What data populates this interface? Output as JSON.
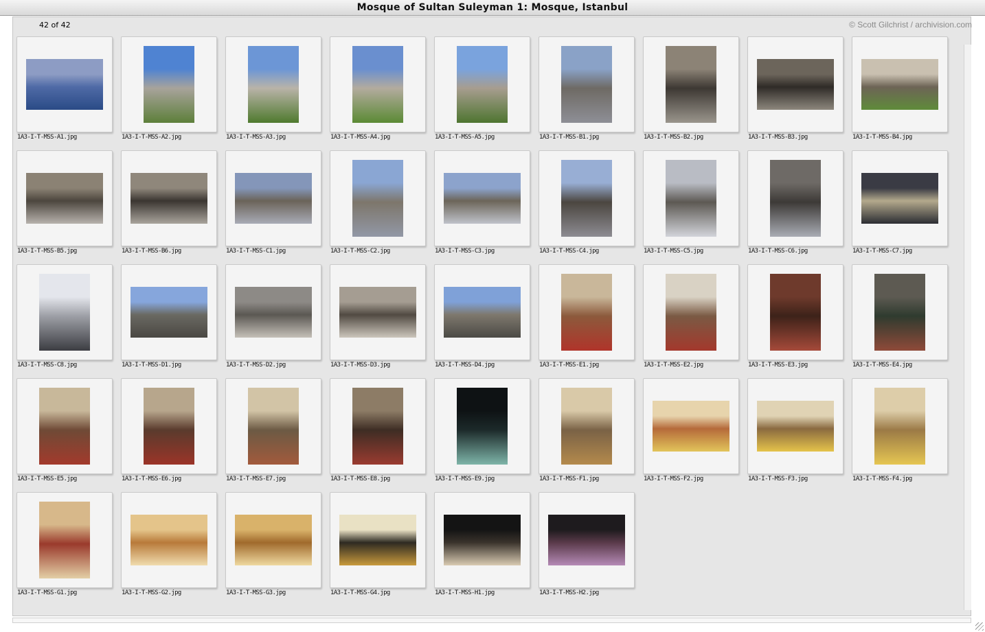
{
  "window": {
    "title": "Mosque of Sultan Suleyman 1: Mosque, Istanbul",
    "count_label": "42 of 42",
    "credit": "© Scott Gilchrist / archivision.com"
  },
  "thumbnails": [
    {
      "file": "1A3-I-T-MSS-A1.jpg",
      "orientation": "landscape",
      "colors": [
        "#8d9cc4",
        "#4f6aa6",
        "#2a4b86"
      ]
    },
    {
      "file": "1A3-I-T-MSS-A2.jpg",
      "orientation": "portrait",
      "colors": [
        "#4f83d2",
        "#a8a39b",
        "#5d7f3a"
      ]
    },
    {
      "file": "1A3-I-T-MSS-A3.jpg",
      "orientation": "portrait",
      "colors": [
        "#6c96d6",
        "#b9b3a8",
        "#4f7a2e"
      ]
    },
    {
      "file": "1A3-I-T-MSS-A4.jpg",
      "orientation": "portrait",
      "colors": [
        "#6a8fcf",
        "#b3ab9e",
        "#5b8a34"
      ]
    },
    {
      "file": "1A3-I-T-MSS-A5.jpg",
      "orientation": "portrait",
      "colors": [
        "#7aa3dd",
        "#a79d8f",
        "#4e7530"
      ]
    },
    {
      "file": "1A3-I-T-MSS-B1.jpg",
      "orientation": "portrait",
      "colors": [
        "#8aa2c7",
        "#6e6a64",
        "#8e8f96"
      ]
    },
    {
      "file": "1A3-I-T-MSS-B2.jpg",
      "orientation": "portrait",
      "colors": [
        "#8c8376",
        "#3d3833",
        "#9a958c"
      ]
    },
    {
      "file": "1A3-I-T-MSS-B3.jpg",
      "orientation": "landscape",
      "colors": [
        "#6c655b",
        "#2f2b27",
        "#8d877d"
      ]
    },
    {
      "file": "1A3-I-T-MSS-B4.jpg",
      "orientation": "landscape",
      "colors": [
        "#c9c0b0",
        "#6d6456",
        "#5f8b3a"
      ]
    },
    {
      "file": "1A3-I-T-MSS-B5.jpg",
      "orientation": "landscape",
      "colors": [
        "#8b8274",
        "#4c463e",
        "#b7b2ad"
      ]
    },
    {
      "file": "1A3-I-T-MSS-B6.jpg",
      "orientation": "landscape",
      "colors": [
        "#8f877b",
        "#3b3631",
        "#a9a49c"
      ]
    },
    {
      "file": "1A3-I-T-MSS-C1.jpg",
      "orientation": "landscape",
      "colors": [
        "#8496b9",
        "#6b6359",
        "#a8abb6"
      ]
    },
    {
      "file": "1A3-I-T-MSS-C2.jpg",
      "orientation": "portrait",
      "colors": [
        "#8aa6d3",
        "#7d766b",
        "#9298a6"
      ]
    },
    {
      "file": "1A3-I-T-MSS-C3.jpg",
      "orientation": "landscape",
      "colors": [
        "#8ca3cc",
        "#6c6559",
        "#bfc2ca"
      ]
    },
    {
      "file": "1A3-I-T-MSS-C4.jpg",
      "orientation": "portrait",
      "colors": [
        "#98aed4",
        "#4b4640",
        "#8d8c92"
      ]
    },
    {
      "file": "1A3-I-T-MSS-C5.jpg",
      "orientation": "portrait",
      "colors": [
        "#b9bcc4",
        "#5d5953",
        "#d2d4da"
      ]
    },
    {
      "file": "1A3-I-T-MSS-C6.jpg",
      "orientation": "portrait",
      "colors": [
        "#6e6a66",
        "#3d3a37",
        "#a9acb4"
      ]
    },
    {
      "file": "1A3-I-T-MSS-C7.jpg",
      "orientation": "landscape",
      "colors": [
        "#3a3b44",
        "#b3a98c",
        "#2c2d33"
      ]
    },
    {
      "file": "1A3-I-T-MSS-C8.jpg",
      "orientation": "portrait",
      "colors": [
        "#e4e6ec",
        "#9d9fa6",
        "#3c3d42"
      ]
    },
    {
      "file": "1A3-I-T-MSS-D1.jpg",
      "orientation": "landscape",
      "colors": [
        "#86a6dc",
        "#6a6962",
        "#4a4843"
      ]
    },
    {
      "file": "1A3-I-T-MSS-D2.jpg",
      "orientation": "landscape",
      "colors": [
        "#8d8a86",
        "#5b5853",
        "#c5c0b8"
      ]
    },
    {
      "file": "1A3-I-T-MSS-D3.jpg",
      "orientation": "landscape",
      "colors": [
        "#a59d92",
        "#514a42",
        "#ccc6bc"
      ]
    },
    {
      "file": "1A3-I-T-MSS-D4.jpg",
      "orientation": "landscape",
      "colors": [
        "#7fa1d8",
        "#7e786d",
        "#4b4a45"
      ]
    },
    {
      "file": "1A3-I-T-MSS-E1.jpg",
      "orientation": "portrait",
      "colors": [
        "#c9b79a",
        "#8c5a3c",
        "#b0342a"
      ]
    },
    {
      "file": "1A3-I-T-MSS-E2.jpg",
      "orientation": "portrait",
      "colors": [
        "#d9d2c4",
        "#7a5a44",
        "#a4382c"
      ]
    },
    {
      "file": "1A3-I-T-MSS-E3.jpg",
      "orientation": "portrait",
      "colors": [
        "#6e3a2c",
        "#3d2219",
        "#a64a3a"
      ]
    },
    {
      "file": "1A3-I-T-MSS-E4.jpg",
      "orientation": "portrait",
      "colors": [
        "#5d5a52",
        "#2f3b2f",
        "#8f4a39"
      ]
    },
    {
      "file": "1A3-I-T-MSS-E5.jpg",
      "orientation": "portrait",
      "colors": [
        "#c8b89a",
        "#6f4a36",
        "#a33a2c"
      ]
    },
    {
      "file": "1A3-I-T-MSS-E6.jpg",
      "orientation": "portrait",
      "colors": [
        "#b7a68c",
        "#5a3b2d",
        "#9b3428"
      ]
    },
    {
      "file": "1A3-I-T-MSS-E7.jpg",
      "orientation": "portrait",
      "colors": [
        "#d2c4a6",
        "#6c5a44",
        "#a25a3c"
      ]
    },
    {
      "file": "1A3-I-T-MSS-E8.jpg",
      "orientation": "portrait",
      "colors": [
        "#8d7c66",
        "#3e2d24",
        "#9a3b30"
      ]
    },
    {
      "file": "1A3-I-T-MSS-E9.jpg",
      "orientation": "portrait",
      "colors": [
        "#0e1214",
        "#1c2a2a",
        "#7fb5a9"
      ]
    },
    {
      "file": "1A3-I-T-MSS-F1.jpg",
      "orientation": "portrait",
      "colors": [
        "#d9c9a8",
        "#7a6246",
        "#b48a4c"
      ]
    },
    {
      "file": "1A3-I-T-MSS-F2.jpg",
      "orientation": "landscape",
      "colors": [
        "#e7d4ac",
        "#b56a3a",
        "#e2c45a"
      ]
    },
    {
      "file": "1A3-I-T-MSS-F3.jpg",
      "orientation": "landscape",
      "colors": [
        "#e0d3b4",
        "#8a6a40",
        "#e5c34a"
      ]
    },
    {
      "file": "1A3-I-T-MSS-F4.jpg",
      "orientation": "portrait",
      "colors": [
        "#ddcda9",
        "#9b7a46",
        "#e6c652"
      ]
    },
    {
      "file": "1A3-I-T-MSS-G1.jpg",
      "orientation": "portrait",
      "colors": [
        "#d7b88a",
        "#9a3a2c",
        "#e3cfa6"
      ]
    },
    {
      "file": "1A3-I-T-MSS-G2.jpg",
      "orientation": "landscape",
      "colors": [
        "#e4c48a",
        "#b87a3a",
        "#f0dcae"
      ]
    },
    {
      "file": "1A3-I-T-MSS-G3.jpg",
      "orientation": "landscape",
      "colors": [
        "#d9b26a",
        "#a06a2c",
        "#efd9a0"
      ]
    },
    {
      "file": "1A3-I-T-MSS-G4.jpg",
      "orientation": "landscape",
      "colors": [
        "#e9e1c4",
        "#2e2a22",
        "#c89a3c"
      ]
    },
    {
      "file": "1A3-I-T-MSS-H1.jpg",
      "orientation": "landscape",
      "colors": [
        "#141414",
        "#3a332c",
        "#d9cbb2"
      ]
    },
    {
      "file": "1A3-I-T-MSS-H2.jpg",
      "orientation": "landscape",
      "colors": [
        "#1e1b1e",
        "#5a3a4a",
        "#b58ab6"
      ]
    }
  ]
}
